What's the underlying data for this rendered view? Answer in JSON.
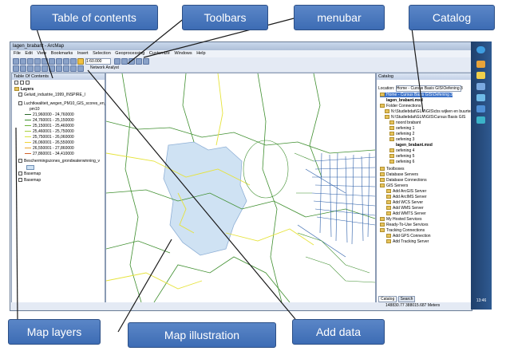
{
  "callouts": {
    "table_of_contents": "Table of contents",
    "toolbars": "Toolbars",
    "menubar": "menubar",
    "catalog": "Catalog",
    "map_layers": "Map layers",
    "map_illustration": "Map illustration",
    "add_data": "Add data"
  },
  "window": {
    "title": "lagen_brabant - ArcMap",
    "menus": [
      "File",
      "Edit",
      "View",
      "Bookmarks",
      "Insert",
      "Selection",
      "Geoprocessing",
      "Customize",
      "Windows",
      "Help"
    ],
    "scale": "1:60.000",
    "network_analyst": "Network Analyst"
  },
  "toc": {
    "title": "Table Of Contents",
    "layers_label": "Layers",
    "items": [
      "Geluid_industrie_1999_INSPIRE_l",
      "Luchtkwaliteit_wegen_PM10_GIS_scores_en_in",
      "pm10",
      "21,960000 - 24,760000",
      "24,760001 - 25,150000",
      "25,150001 - 25,460000",
      "25,460001 - 25,750000",
      "25,750001 - 26,060000",
      "26,060001 - 26,550000",
      "26,550001 - 27,860000",
      "27,860001 - 34,410000",
      "Beschermingszones_grondwaterwinning_v",
      "Basemap",
      "Basemap"
    ],
    "legend_colors": [
      "#2b6a2b",
      "#3f8f2f",
      "#6cb33a",
      "#a9cf3e",
      "#d9e23f",
      "#f0d437",
      "#e9a72f",
      "#d1622a"
    ]
  },
  "catalog": {
    "title": "Catalog",
    "location_label": "Location:",
    "location_value": "Home - Cursus Basis GIS\\Oefening 3",
    "items": [
      "Home - Cursus Basis GIS\\Oefening 3",
      "lagen_brabant.mxd",
      "Folder Connections",
      "N:\\Studiebdat\\GLM\\GIS\\cbs wijken en buurten",
      "N:\\Studiebdat\\GLM\\GIS\\Cursus Basis GIS",
      "noord brabant",
      "oefening 1",
      "oefening 2",
      "oefening 3",
      "lagen_brabant.mxd",
      "oefening 4",
      "oefening 5",
      "oefening 6",
      "Toolboxes",
      "Database Servers",
      "Database Connections",
      "GIS Servers",
      "Add ArcGIS Server",
      "Add ArcIMS Server",
      "Add WCS Server",
      "Add WMS Server",
      "Add WMTS Server",
      "My Hosted Services",
      "Ready-To-Use Services",
      "Tracking Connections",
      "Add GPS Connection",
      "Add Tracking Server"
    ],
    "tabs": [
      "Catalog",
      "Search"
    ]
  },
  "status": {
    "coords": "148830.77 388015.687 Meters"
  },
  "taskbar": {
    "clock": "13:46"
  },
  "colors": {
    "callout": "#4a79c0",
    "map_area": "#cfe2f3",
    "road_green": "#3f8f2f",
    "road_yellow": "#e6e33a",
    "road_blue": "#2a5da8"
  }
}
